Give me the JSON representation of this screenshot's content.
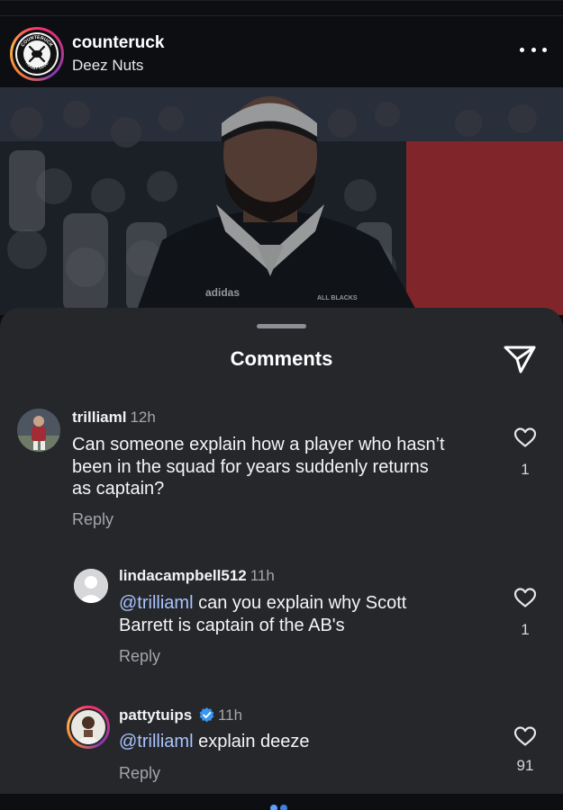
{
  "post": {
    "username": "counteruck",
    "subtitle": "Deez Nuts",
    "logo_text_top": "COUNTERUCK",
    "logo_text_bottom": "RUGBY CLUB",
    "more_icon": "more-horizontal-icon",
    "image": {
      "jersey_brand": "adidas",
      "jersey_text": "ALL BLACKS"
    }
  },
  "comments_sheet": {
    "title": "Comments",
    "share_icon": "send-icon",
    "comments": [
      {
        "user": "trilliaml",
        "time": "12h",
        "text_lines": [
          "Can someone explain how a player who hasn’t",
          "been in the squad for years suddenly returns",
          "as captain?"
        ],
        "reply_label": "Reply",
        "likes": "1"
      },
      {
        "user": "lindacampbell512",
        "time": "11h",
        "mention": "@trilliaml",
        "text_line1_rest": " can you explain why Scott",
        "text_line2": "Barrett is captain of the AB's",
        "reply_label": "Reply",
        "likes": "1"
      },
      {
        "user": "pattytuips",
        "verified": true,
        "time": "11h",
        "mention": "@trilliaml",
        "text_rest": " explain deeze",
        "reply_label": "Reply",
        "likes": "91"
      }
    ]
  },
  "colors": {
    "sheet_bg": "#25272b",
    "mention": "#a9c4ff",
    "verified_badge": "#3897f0",
    "story_ring": "#c13584"
  }
}
